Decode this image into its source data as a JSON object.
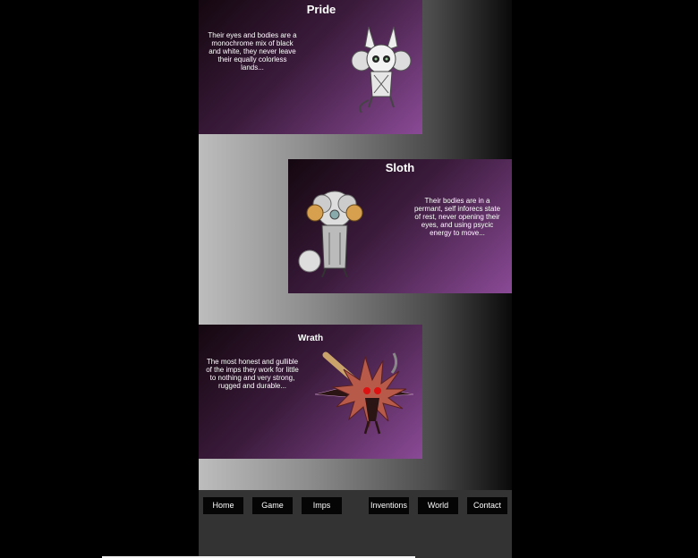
{
  "cards": [
    {
      "title": "Pride",
      "description": "Their eyes and bodies are a monochrome mix of black and white, they never leave their equally colorless lands..."
    },
    {
      "title": "Sloth",
      "description": "Their bodies are in a permant, self inforecs state of rest, never opening their eyes, and using psycic energy to move..."
    },
    {
      "title": "Wrath",
      "description": "The most honest and gullible of the imps they work for little to nothing and very strong, rugged and durable..."
    }
  ],
  "nav": {
    "home": "Home",
    "game": "Game",
    "imps": "Imps",
    "inventions": "Inventions",
    "world": "World",
    "contact": "Contact"
  }
}
